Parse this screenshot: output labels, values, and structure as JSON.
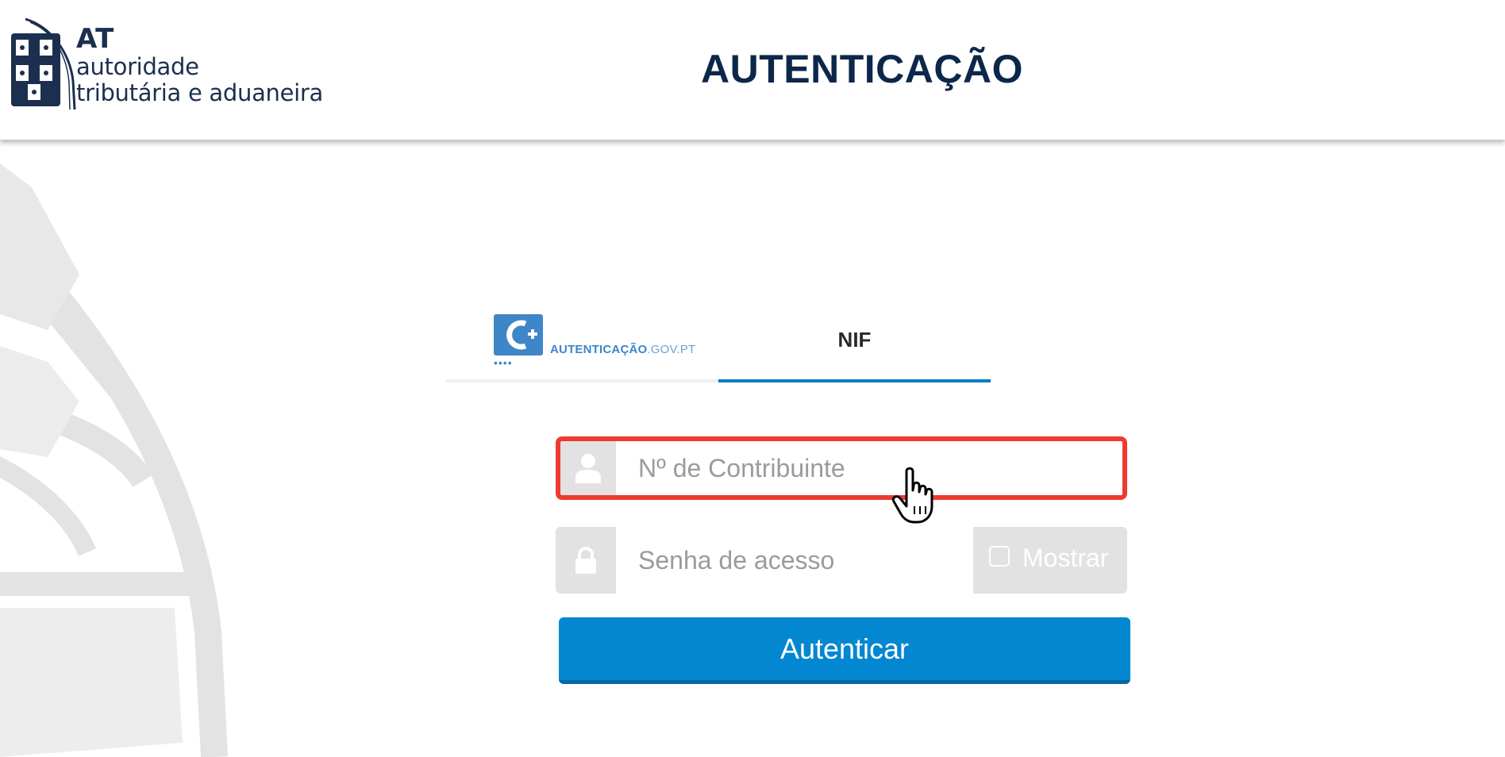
{
  "header": {
    "logo": {
      "abbr": "AT",
      "line1": "autoridade",
      "line2": "tributária e aduaneira"
    },
    "title": "AUTENTICAÇÃO"
  },
  "tabs": [
    {
      "id": "govpt",
      "icon": "autenticacao-gov-icon",
      "label_main": "AUTENTICAÇÃO",
      "label_suffix": ".GOV.PT",
      "active": false
    },
    {
      "id": "nif",
      "label": "NIF",
      "active": true
    }
  ],
  "form": {
    "nif": {
      "icon": "user-icon",
      "placeholder": "Nº de Contribuinte",
      "value": "",
      "highlighted": true
    },
    "password": {
      "icon": "lock-icon",
      "placeholder": "Senha de acesso",
      "value": "",
      "show_label": "Mostrar",
      "show_checked": false
    },
    "submit_label": "Autenticar"
  },
  "colors": {
    "brand_navy": "#0c2749",
    "accent_blue": "#0387d0",
    "tab_active": "#0a7cc2",
    "highlight_red": "#ed3b30",
    "field_gray": "#e2e2e2",
    "govpt_blue": "#3e86c8"
  },
  "cursor": "hand-pointer-icon"
}
